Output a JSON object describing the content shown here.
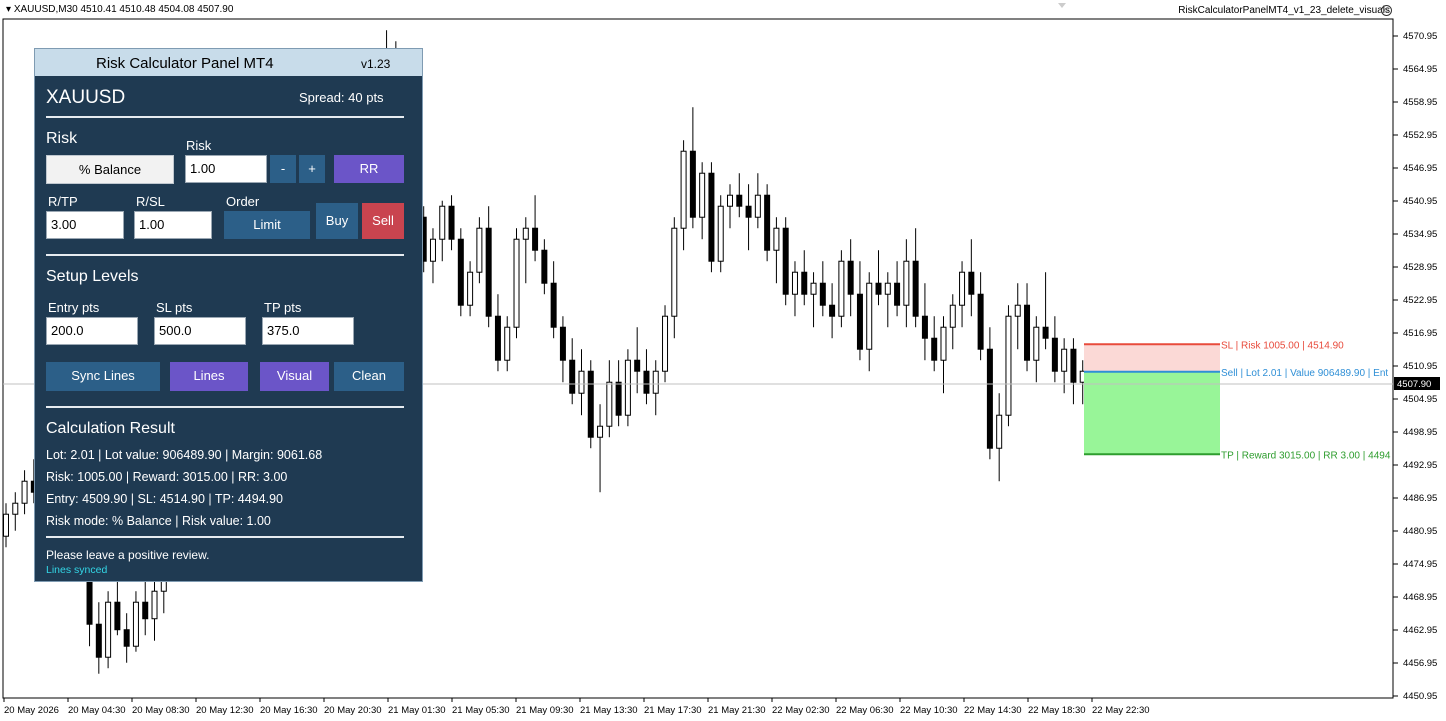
{
  "header": {
    "symbol_info": "XAUUSD,M30  4510.41 4510.48 4504.08 4507.90",
    "ea_name": "RiskCalculatorPanelMT4_v1_23_delete_visuals",
    "close_icon": "close-circle-icon"
  },
  "panel": {
    "title": "Risk Calculator Panel MT4",
    "version": "v1.23",
    "symbol": "XAUUSD",
    "spread": "Spread: 40 pts",
    "risk_section": "Risk",
    "risk_mode_button": "% Balance",
    "risk_label": "Risk",
    "risk_value": "1.00",
    "minus_label": "-",
    "plus_label": "+",
    "rr_label": "RR",
    "rtp_label": "R/TP",
    "rtp_value": "3.00",
    "rsl_label": "R/SL",
    "rsl_value": "1.00",
    "order_label": "Order",
    "order_type": "Limit",
    "buy_label": "Buy",
    "sell_label": "Sell",
    "setup_section": "Setup Levels",
    "entry_label": "Entry pts",
    "entry_value": "200.0",
    "sl_label": "SL pts",
    "sl_value": "500.0",
    "tp_label": "TP pts",
    "tp_value": "375.0",
    "sync_label": "Sync Lines",
    "lines_label": "Lines",
    "visual_label": "Visual",
    "clean_label": "Clean",
    "result_section": "Calculation Result",
    "result_lines": [
      "Lot: 2.01 | Lot value: 906489.90 | Margin: 9061.68",
      "Risk: 1005.00 | Reward: 3015.00 | RR: 3.00",
      "Entry: 4509.90 | SL: 4514.90 | TP: 4494.90",
      "Risk mode: % Balance | Risk value: 1.00"
    ],
    "footer_note": "Please leave a positive review.",
    "status": "Lines synced"
  },
  "chart_data": {
    "type": "candlestick",
    "symbol": "XAUUSD",
    "timeframe": "M30",
    "y_ticks": [
      "4570.95",
      "4564.95",
      "4558.95",
      "4552.95",
      "4546.95",
      "4540.95",
      "4534.95",
      "4528.95",
      "4522.95",
      "4516.95",
      "4510.95",
      "4504.95",
      "4498.95",
      "4492.95",
      "4486.95",
      "4480.95",
      "4474.95",
      "4468.95",
      "4462.95",
      "4456.95",
      "4450.95"
    ],
    "ylim": [
      4450.95,
      4570.95
    ],
    "x_ticks": [
      "20 May 2026",
      "20 May 04:30",
      "20 May 08:30",
      "20 May 12:30",
      "20 May 16:30",
      "20 May 20:30",
      "21 May 01:30",
      "21 May 05:30",
      "21 May 09:30",
      "21 May 13:30",
      "21 May 17:30",
      "21 May 21:30",
      "22 May 02:30",
      "22 May 06:30",
      "22 May 10:30",
      "22 May 14:30",
      "22 May 18:30",
      "22 May 22:30"
    ],
    "current_price": "4507.90",
    "candles_ohlc": [
      [
        4480,
        4486,
        4478,
        4484
      ],
      [
        4484,
        4488,
        4481,
        4486
      ],
      [
        4486,
        4492,
        4484,
        4490
      ],
      [
        4490,
        4494,
        4486,
        4488
      ],
      [
        4488,
        4495,
        4485,
        4493
      ],
      [
        4493,
        4500,
        4490,
        4498
      ],
      [
        4498,
        4503,
        4493,
        4496
      ],
      [
        4496,
        4500,
        4486,
        4488
      ],
      [
        4488,
        4492,
        4472,
        4476
      ],
      [
        4476,
        4478,
        4460,
        4464
      ],
      [
        4464,
        4468,
        4455,
        4458
      ],
      [
        4458,
        4470,
        4456,
        4468
      ],
      [
        4468,
        4474,
        4462,
        4463
      ],
      [
        4463,
        4466,
        4457,
        4460
      ],
      [
        4460,
        4470,
        4459,
        4468
      ],
      [
        4468,
        4476,
        4462,
        4465
      ],
      [
        4465,
        4472,
        4461,
        4470
      ],
      [
        4470,
        4478,
        4466,
        4476
      ],
      [
        4476,
        4484,
        4472,
        4480
      ],
      [
        4480,
        4486,
        4474,
        4478
      ],
      [
        4478,
        4488,
        4476,
        4486
      ],
      [
        4486,
        4494,
        4482,
        4490
      ],
      [
        4490,
        4498,
        4486,
        4494
      ],
      [
        4494,
        4500,
        4488,
        4492
      ],
      [
        4492,
        4496,
        4484,
        4488
      ],
      [
        4488,
        4494,
        4480,
        4490
      ],
      [
        4490,
        4500,
        4486,
        4498
      ],
      [
        4498,
        4506,
        4494,
        4502
      ],
      [
        4502,
        4508,
        4497,
        4500
      ],
      [
        4500,
        4504,
        4490,
        4496
      ],
      [
        4496,
        4500,
        4486,
        4492
      ],
      [
        4492,
        4498,
        4488,
        4496
      ],
      [
        4496,
        4504,
        4492,
        4502
      ],
      [
        4502,
        4510,
        4498,
        4508
      ],
      [
        4508,
        4514,
        4504,
        4512
      ],
      [
        4512,
        4520,
        4508,
        4518
      ],
      [
        4518,
        4526,
        4514,
        4524
      ],
      [
        4524,
        4534,
        4520,
        4532
      ],
      [
        4532,
        4546,
        4528,
        4544
      ],
      [
        4544,
        4556,
        4540,
        4552
      ],
      [
        4552,
        4564,
        4548,
        4562
      ],
      [
        4562,
        4572,
        4558,
        4568
      ],
      [
        4566,
        4570,
        4538,
        4540
      ],
      [
        4540,
        4542,
        4532,
        4534
      ],
      [
        4534,
        4540,
        4530,
        4538
      ],
      [
        4538,
        4540,
        4528,
        4530
      ],
      [
        4530,
        4536,
        4526,
        4534
      ],
      [
        4534,
        4541,
        4530,
        4540
      ],
      [
        4540,
        4542,
        4532,
        4534
      ],
      [
        4534,
        4536,
        4520,
        4522
      ],
      [
        4522,
        4530,
        4520,
        4528
      ],
      [
        4528,
        4538,
        4526,
        4536
      ],
      [
        4536,
        4540,
        4518,
        4520
      ],
      [
        4520,
        4524,
        4510,
        4512
      ],
      [
        4512,
        4520,
        4510,
        4518
      ],
      [
        4518,
        4536,
        4516,
        4534
      ],
      [
        4534,
        4538,
        4526,
        4536
      ],
      [
        4536,
        4542,
        4530,
        4532
      ],
      [
        4532,
        4534,
        4524,
        4526
      ],
      [
        4526,
        4530,
        4516,
        4518
      ],
      [
        4518,
        4520,
        4508,
        4512
      ],
      [
        4512,
        4516,
        4504,
        4506
      ],
      [
        4506,
        4514,
        4502,
        4510
      ],
      [
        4510,
        4512,
        4496,
        4498
      ],
      [
        4498,
        4504,
        4488,
        4500
      ],
      [
        4500,
        4512,
        4498,
        4508
      ],
      [
        4508,
        4512,
        4500,
        4502
      ],
      [
        4502,
        4514,
        4500,
        4512
      ],
      [
        4512,
        4518,
        4506,
        4510
      ],
      [
        4510,
        4514,
        4504,
        4506
      ],
      [
        4506,
        4512,
        4502,
        4510
      ],
      [
        4510,
        4522,
        4508,
        4520
      ],
      [
        4520,
        4538,
        4516,
        4536
      ],
      [
        4536,
        4552,
        4532,
        4550
      ],
      [
        4550,
        4558,
        4536,
        4538
      ],
      [
        4538,
        4548,
        4534,
        4546
      ],
      [
        4546,
        4548,
        4528,
        4530
      ],
      [
        4530,
        4542,
        4528,
        4540
      ],
      [
        4540,
        4544,
        4536,
        4542
      ],
      [
        4542,
        4546,
        4538,
        4540
      ],
      [
        4540,
        4544,
        4532,
        4538
      ],
      [
        4538,
        4546,
        4536,
        4542
      ],
      [
        4542,
        4544,
        4530,
        4532
      ],
      [
        4532,
        4538,
        4526,
        4536
      ],
      [
        4536,
        4538,
        4522,
        4524
      ],
      [
        4524,
        4530,
        4520,
        4528
      ],
      [
        4528,
        4532,
        4522,
        4524
      ],
      [
        4524,
        4528,
        4518,
        4526
      ],
      [
        4526,
        4530,
        4520,
        4522
      ],
      [
        4522,
        4526,
        4516,
        4520
      ],
      [
        4520,
        4532,
        4518,
        4530
      ],
      [
        4530,
        4534,
        4520,
        4524
      ],
      [
        4524,
        4530,
        4512,
        4514
      ],
      [
        4514,
        4528,
        4510,
        4526
      ],
      [
        4526,
        4532,
        4522,
        4524
      ],
      [
        4524,
        4528,
        4518,
        4526
      ],
      [
        4526,
        4530,
        4520,
        4522
      ],
      [
        4522,
        4534,
        4518,
        4530
      ],
      [
        4530,
        4536,
        4518,
        4520
      ],
      [
        4520,
        4526,
        4512,
        4516
      ],
      [
        4516,
        4520,
        4510,
        4512
      ],
      [
        4512,
        4520,
        4506,
        4518
      ],
      [
        4518,
        4524,
        4514,
        4522
      ],
      [
        4522,
        4530,
        4518,
        4528
      ],
      [
        4528,
        4534,
        4520,
        4524
      ],
      [
        4524,
        4528,
        4512,
        4514
      ],
      [
        4514,
        4518,
        4494,
        4496
      ],
      [
        4496,
        4506,
        4490,
        4502
      ],
      [
        4502,
        4522,
        4500,
        4520
      ],
      [
        4520,
        4526,
        4514,
        4522
      ],
      [
        4522,
        4526,
        4510,
        4512
      ],
      [
        4512,
        4520,
        4508,
        4518
      ],
      [
        4518,
        4528,
        4514,
        4516
      ],
      [
        4516,
        4520,
        4508,
        4510
      ],
      [
        4510,
        4516,
        4506,
        4514
      ],
      [
        4514,
        4516,
        4504,
        4508
      ],
      [
        4508,
        4512,
        4504,
        4510
      ],
      [
        4510,
        4512,
        4506,
        4507.9
      ]
    ],
    "levels": [
      {
        "label": "SL | Risk 1005.00 | 4514.90",
        "price": 4514.9,
        "color": "#e84b3c"
      },
      {
        "label": "Sell | Lot 2.01 | Value 906489.90 | Ent",
        "price": 4509.9,
        "color": "#2f8fd6"
      },
      {
        "label": "TP | Reward 3015.00 | RR 3.00 | 4494",
        "price": 4494.9,
        "color": "#2e9d2e"
      }
    ]
  }
}
